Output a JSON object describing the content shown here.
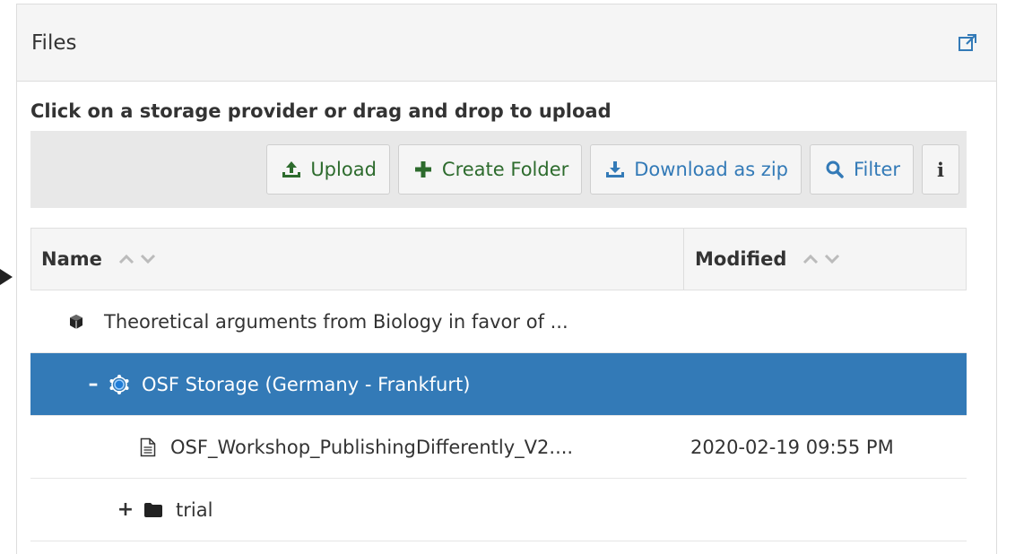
{
  "panel": {
    "title": "Files",
    "external_link_icon": "external-link-icon"
  },
  "instructions": "Click on a storage provider or drag and drop to upload",
  "toolbar": {
    "upload_label": "Upload",
    "create_folder_label": "Create Folder",
    "download_zip_label": "Download as zip",
    "filter_label": "Filter",
    "info_label": "i"
  },
  "grid": {
    "columns": {
      "name": "Name",
      "modified": "Modified"
    },
    "rows": [
      {
        "toggle": "",
        "icon": "cube-icon",
        "name": "Theoretical arguments from Biology in favor of ...",
        "modified": ""
      },
      {
        "toggle": "–",
        "icon": "storage-icon",
        "name": "OSF Storage (Germany - Frankfurt)",
        "modified": ""
      },
      {
        "toggle": "",
        "icon": "file-icon",
        "name": "OSF_Workshop_PublishingDifferently_V2....",
        "modified": "2020-02-19 09:55 PM"
      },
      {
        "toggle": "+",
        "icon": "folder-icon",
        "name": "trial",
        "modified": ""
      }
    ]
  },
  "colors": {
    "selected_row": "#337ab7",
    "link_blue": "#337ab7",
    "green": "#2d6b2d"
  }
}
